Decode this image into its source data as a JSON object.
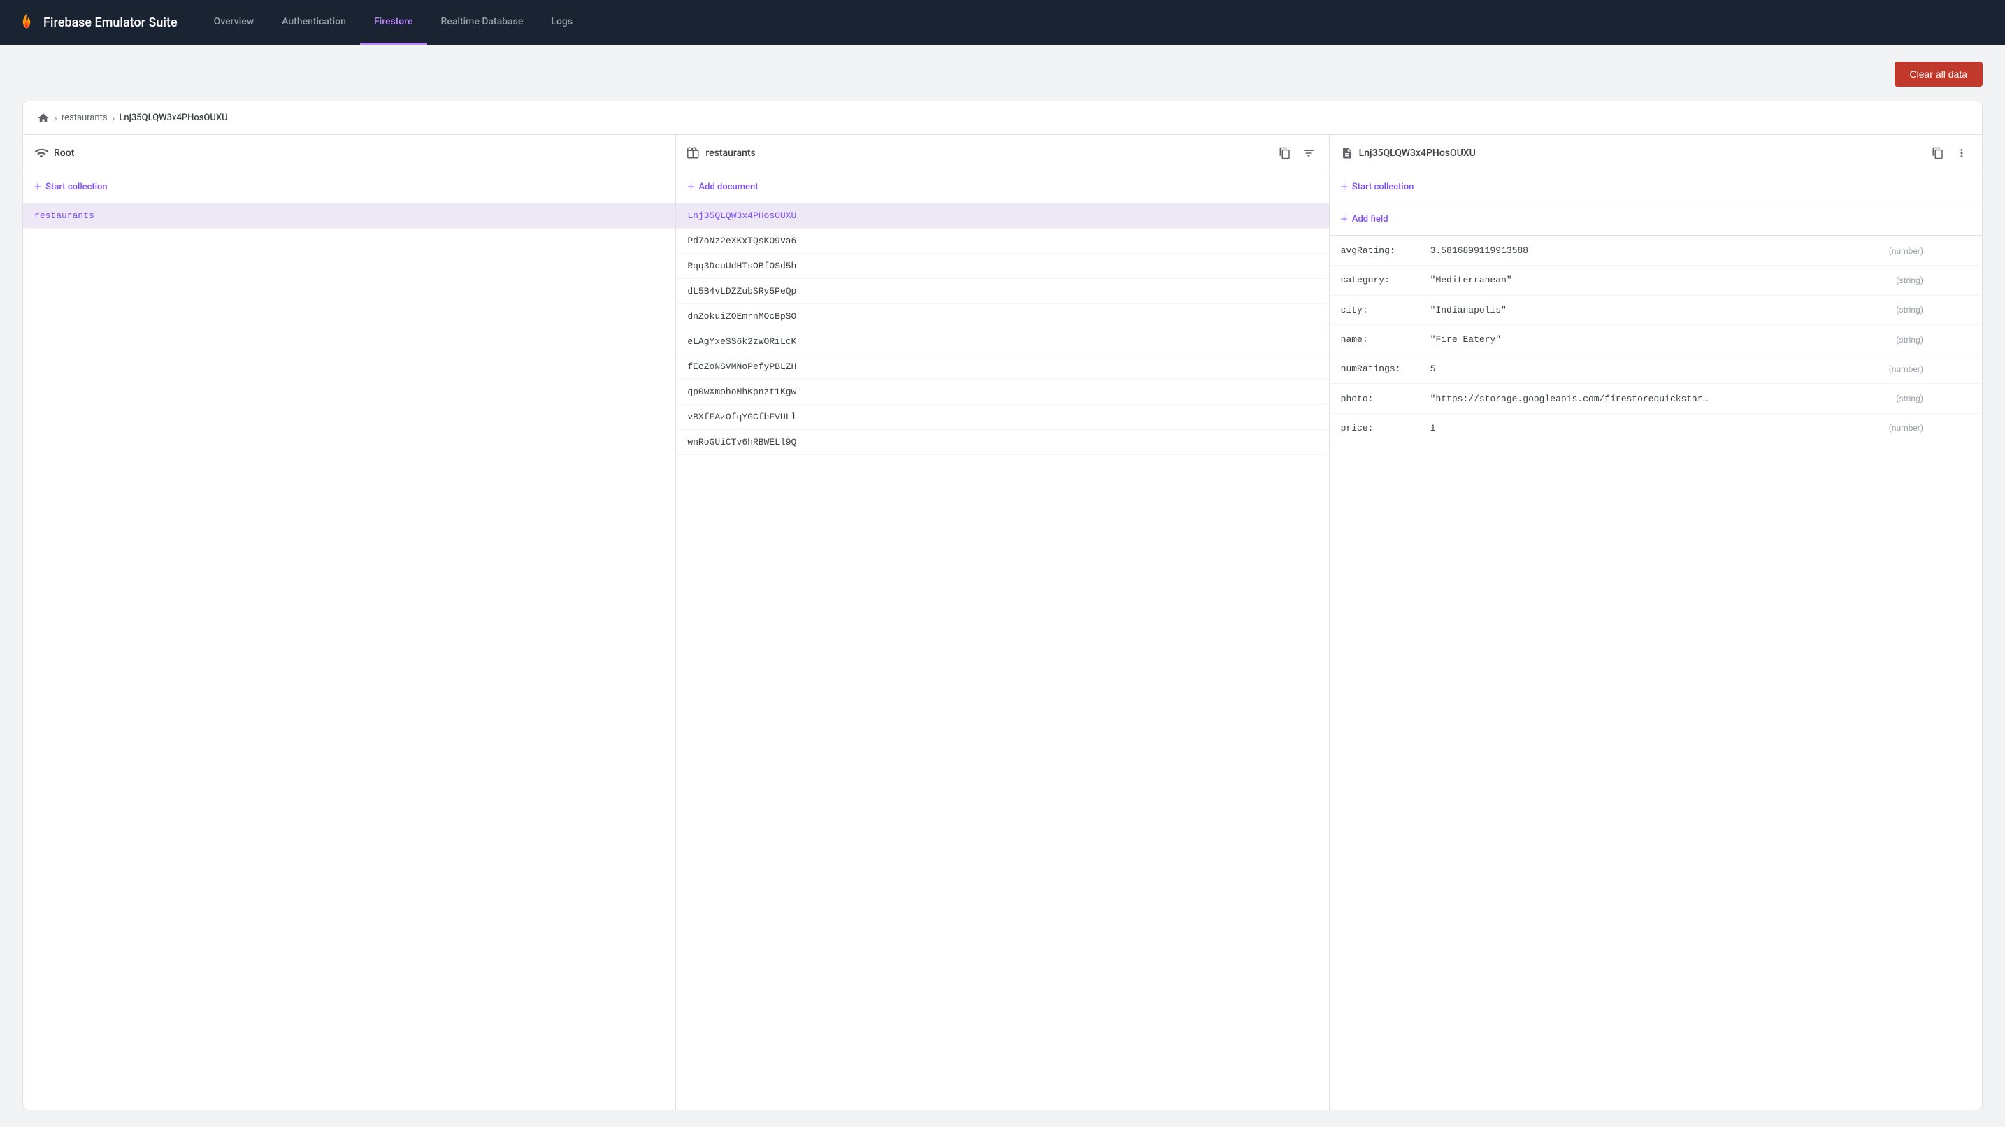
{
  "app": {
    "title": "Firebase Emulator Suite"
  },
  "nav": {
    "links": [
      {
        "id": "overview",
        "label": "Overview",
        "active": false
      },
      {
        "id": "authentication",
        "label": "Authentication",
        "active": false
      },
      {
        "id": "firestore",
        "label": "Firestore",
        "active": true
      },
      {
        "id": "realtime-database",
        "label": "Realtime Database",
        "active": false
      },
      {
        "id": "logs",
        "label": "Logs",
        "active": false
      }
    ]
  },
  "toolbar": {
    "clear_button_label": "Clear all data"
  },
  "breadcrumb": {
    "home_icon": "🏠",
    "sep": "›",
    "collection": "restaurants",
    "document": "Lnj35QLQW3x4PHosOUXU"
  },
  "columns": {
    "root": {
      "title": "Root",
      "add_label": "Start collection",
      "items": [
        {
          "id": "restaurants",
          "label": "restaurants",
          "active": true
        }
      ]
    },
    "restaurants": {
      "title": "restaurants",
      "add_label": "Add document",
      "items": [
        {
          "id": "Lnj35QLQW3x4PHosOUXU",
          "label": "Lnj35QLQW3x4PHosOUXU",
          "active": true
        },
        {
          "id": "Pd7oNz2eXKxTQsKO9va6",
          "label": "Pd7oNz2eXKxTQsKO9va6",
          "active": false
        },
        {
          "id": "Rqq3DcuUdHTsOBfOSd5h",
          "label": "Rqq3DcuUdHTsOBfOSd5h",
          "active": false
        },
        {
          "id": "dL5B4vLDZZubSRy5PeQp",
          "label": "dL5B4vLDZZubSRy5PeQp",
          "active": false
        },
        {
          "id": "dnZokuiZOEmrnMOcBpSO",
          "label": "dnZokuiZOEmrnMOcBpSO",
          "active": false
        },
        {
          "id": "eLAgYxeSS6k2zWORiLcK",
          "label": "eLAgYxeSS6k2zWORiLcK",
          "active": false
        },
        {
          "id": "fEcZoNSVMNoPefyPBLZH",
          "label": "fEcZoNSVMNoPefyPBLZH",
          "active": false
        },
        {
          "id": "qp0wXmohoMhKpnzt1Kgw",
          "label": "qp0wXmohoMhKpnzt1Kgw",
          "active": false
        },
        {
          "id": "vBXfFAzOfqYGCfbFVULl",
          "label": "vBXfFAzOfqYGCfbFVULl",
          "active": false
        },
        {
          "id": "wnRoGUiCTv6hRBWELl9Q",
          "label": "wnRoGUiCTv6hRBWELl9Q",
          "active": false
        }
      ]
    },
    "document": {
      "title": "Lnj35QLQW3x4PHosOUXU",
      "add_label": "Add field",
      "start_collection_label": "Start collection",
      "fields": [
        {
          "key": "avgRating:",
          "value": "3.5816899119913588",
          "type": "(number)"
        },
        {
          "key": "category:",
          "value": "\"Mediterranean\"",
          "type": "(string)"
        },
        {
          "key": "city:",
          "value": "\"Indianapolis\"",
          "type": "(string)"
        },
        {
          "key": "name:",
          "value": "\"Fire Eatery\"",
          "type": "(string)"
        },
        {
          "key": "numRatings:",
          "value": "5",
          "type": "(number)"
        },
        {
          "key": "photo:",
          "value": "\"https://storage.googleapis.com/firestorequickstarts.appspot....",
          "type": "(string)"
        },
        {
          "key": "price:",
          "value": "1",
          "type": "(number)"
        }
      ]
    }
  }
}
